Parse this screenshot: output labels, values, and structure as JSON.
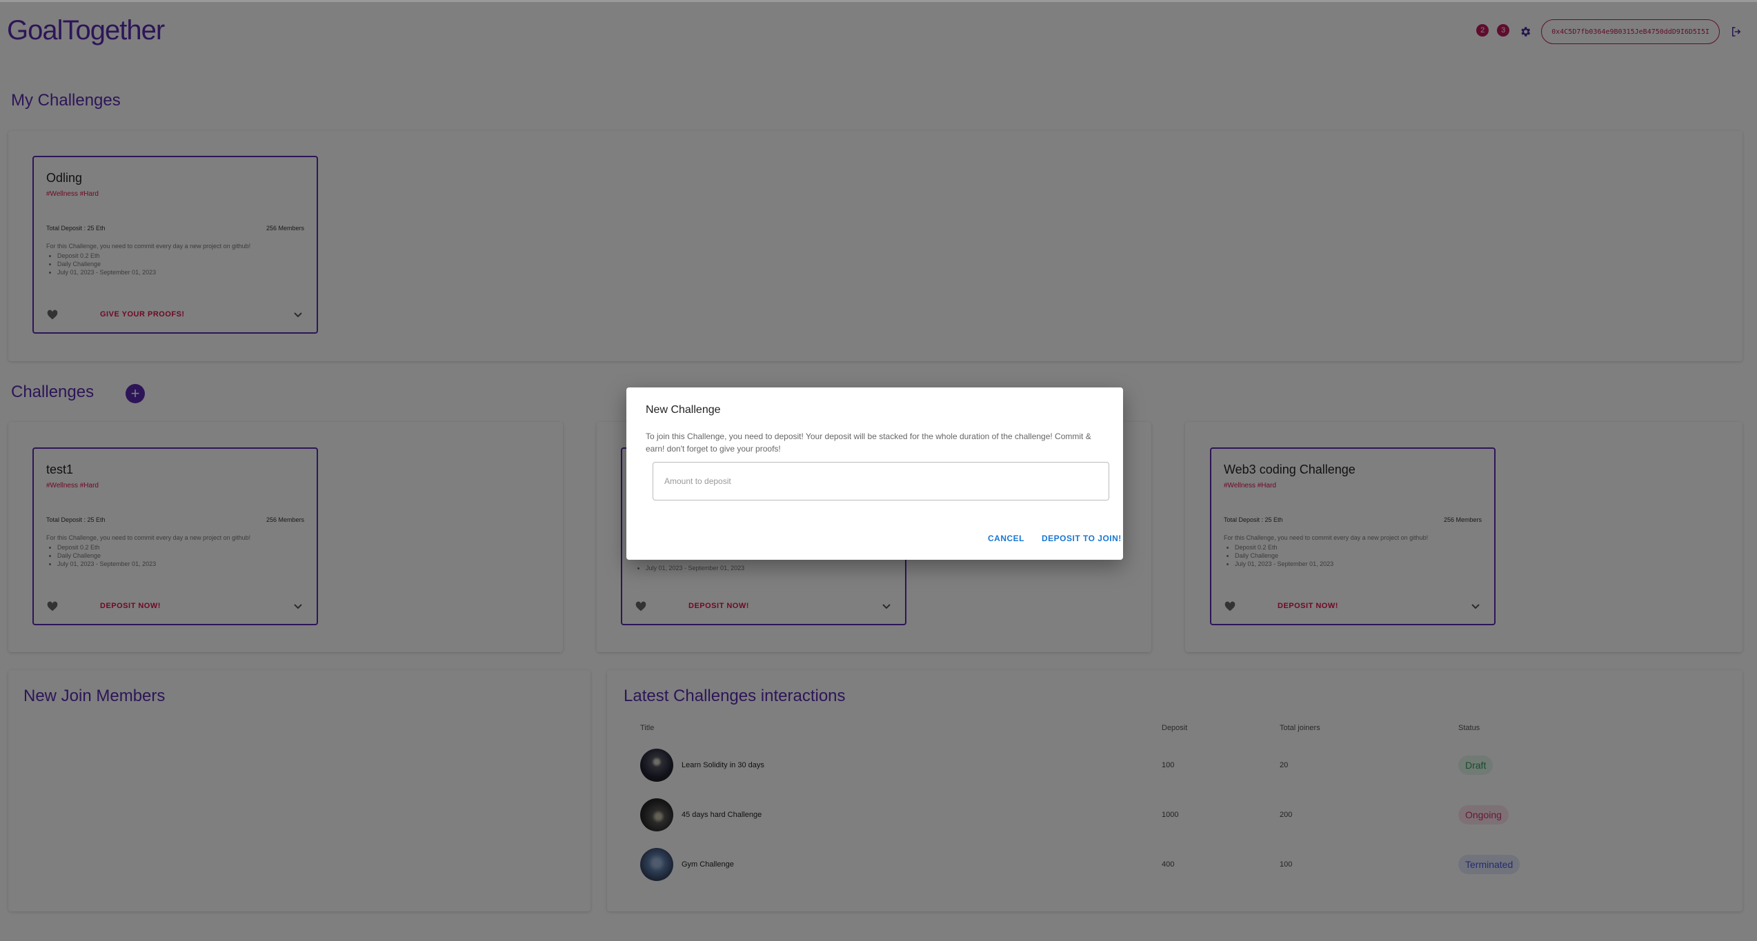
{
  "header": {
    "logo": "GoalTogether",
    "notif1_count": "2",
    "notif2_count": "3",
    "wallet_address": "0x4C5D7fb0364e9B0315JeB4750ddD9I6D5I5I"
  },
  "my_challenges": {
    "title": "My Challenges",
    "cards": [
      {
        "title": "Odling",
        "tags": "#Wellness #Hard",
        "deposit": "Total Deposit : 25 Eth",
        "members": "256 Members",
        "description": "For this Challenge, you need to commit every day a new project on github!",
        "bullets": [
          "Deposit 0.2 Eth",
          "Daily Challenge",
          "July 01, 2023 - September 01, 2023"
        ],
        "action": "GIVE YOUR PROOFS!"
      }
    ]
  },
  "challenges": {
    "title": "Challenges",
    "cards": [
      {
        "title": "test1",
        "tags": "#Wellness #Hard",
        "deposit": "Total Deposit : 25 Eth",
        "members": "256 Members",
        "description": "For this Challenge, you need to commit every day a new project on github!",
        "bullets": [
          "Deposit 0.2 Eth",
          "Daily Challenge",
          "July 01, 2023 - September 01, 2023"
        ],
        "action": "DEPOSIT NOW!"
      },
      {
        "bullets_tail": "July 01, 2023 - September 01, 2023",
        "action": "DEPOSIT NOW!"
      },
      {
        "title": "Web3 coding Challenge",
        "tags": "#Wellness #Hard",
        "deposit": "Total Deposit : 25 Eth",
        "members": "256 Members",
        "description": "For this Challenge, you need to commit every day a new project on github!",
        "bullets": [
          "Deposit 0.2 Eth",
          "Daily Challenge",
          "July 01, 2023 - September 01, 2023"
        ],
        "action": "DEPOSIT NOW!"
      }
    ]
  },
  "new_members": {
    "title": "New Join Members"
  },
  "latest": {
    "title": "Latest Challenges interactions",
    "columns": [
      "Title",
      "Deposit",
      "Total joiners",
      "Status"
    ],
    "rows": [
      {
        "title": "Learn Solidity in 30 days",
        "deposit": "100",
        "joiners": "20",
        "status": "Draft",
        "status_color": "#2e9e5a"
      },
      {
        "title": "45 days hard Challenge",
        "deposit": "1000",
        "joiners": "200",
        "status": "Ongoing",
        "status_color": "#d0306a"
      },
      {
        "title": "Gym Challenge",
        "deposit": "400",
        "joiners": "100",
        "status": "Terminated",
        "status_color": "#4a5bd6"
      }
    ]
  },
  "dialog": {
    "title": "New Challenge",
    "text": "To join this Challenge, you need to deposit! Your deposit will be stacked for the whole duration of the challenge! Commit & earn! don't forget to give your proofs!",
    "input_placeholder": "Amount to deposit",
    "cancel": "CANCEL",
    "confirm": "DEPOSIT TO JOIN!"
  },
  "colors": {
    "brand": "#5a2bb0",
    "accent": "#e0104a",
    "link": "#1976d2"
  }
}
